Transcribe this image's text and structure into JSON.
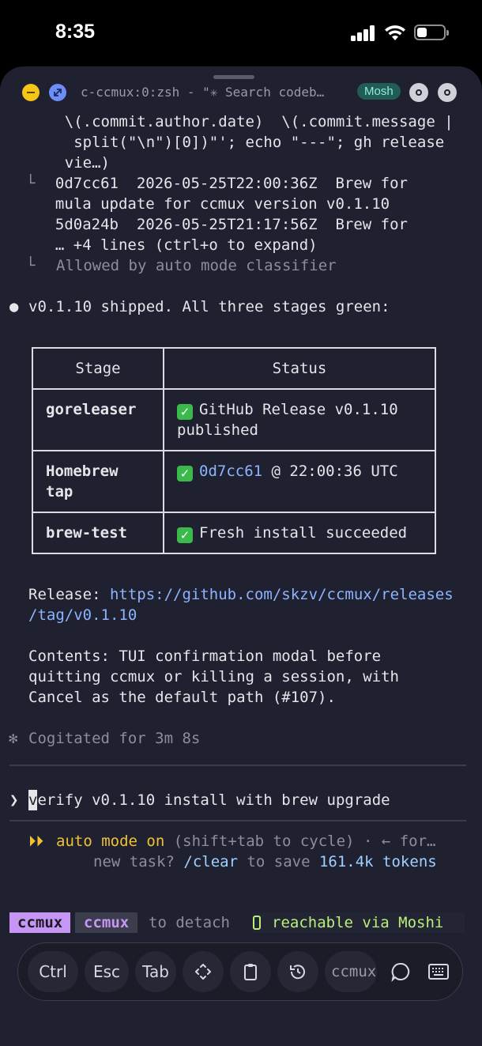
{
  "status": {
    "time": "8:35"
  },
  "window": {
    "title": "c-ccmux:0:zsh - \"✳ Search codeb…",
    "badge": "Mosh"
  },
  "output": {
    "lines": [
      "    \\(.commit.author.date)  \\(.commit.message |",
      "     split(\"\\n\")[0])\"'; echo \"---\"; gh release",
      "    vie…)",
      "  0d7cc61  2026-05-25T22:00:36Z  Brew for",
      "  mula update for ccmux version v0.1.10",
      "  5d0a24b  2026-05-25T21:17:56Z  Brew for",
      "  … +4 lines (ctrl+o to expand)"
    ],
    "allowed": "Allowed by auto mode classifier",
    "summary": "v0.1.10 shipped. All three stages green:"
  },
  "table": {
    "headers": [
      "Stage",
      "Status"
    ],
    "rows": [
      {
        "stage1": "goreleaser",
        "stage2": "",
        "status1": "GitHub Release v0.1.10",
        "status2": "published",
        "hash": "",
        "rest": ""
      },
      {
        "stage1": "Homebrew",
        "stage2": "tap",
        "hash": "0d7cc61",
        "rest": " @ 22:00:36 UTC"
      },
      {
        "stage1": "brew-test",
        "stage2": "",
        "status1": "Fresh install succeeded"
      }
    ]
  },
  "release": {
    "label": "Release:",
    "url1": "https://github.com/skzv/ccmux/releases",
    "url2": "/tag/v0.1.10"
  },
  "contents": {
    "line1": "Contents: TUI confirmation modal before",
    "line2": "quitting ccmux or killing a session, with",
    "line3": "Cancel as the default path (#107)."
  },
  "cogitated": "Cogitated for 3m 8s",
  "prompt": {
    "cursor_char": "v",
    "rest": "erify v0.1.10 install with brew upgrade"
  },
  "mode": {
    "label": "auto mode on",
    "hint": " (shift+tab to cycle) · ← for…",
    "line2a": "new task? ",
    "clear": "/clear",
    "line2b": " to save ",
    "tokens": "161.4k tokens"
  },
  "tmux": {
    "tag1": "ccmux",
    "tag2": "ccmux",
    "detach": "to detach",
    "reach": "reachable via Moshi"
  },
  "keys": {
    "ctrl": "Ctrl",
    "esc": "Esc",
    "tab": "Tab",
    "session": "ccmux"
  }
}
